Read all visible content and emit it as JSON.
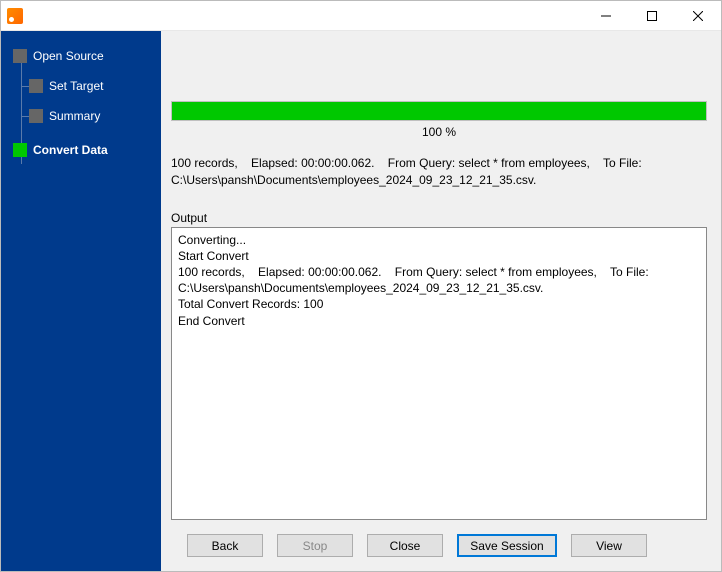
{
  "titlebar": {
    "title": ""
  },
  "sidebar": {
    "items": [
      {
        "label": "Open Source",
        "active": false,
        "bold": false,
        "root": true
      },
      {
        "label": "Set Target",
        "active": false,
        "bold": false,
        "root": false
      },
      {
        "label": "Summary",
        "active": false,
        "bold": false,
        "root": false
      },
      {
        "label": "Convert Data",
        "active": true,
        "bold": true,
        "root": true
      }
    ]
  },
  "progress": {
    "percent": 100,
    "text": "100 %"
  },
  "summary": "100 records,    Elapsed: 00:00:00.062.    From Query: select * from employees,    To File: C:\\Users\\pansh\\Documents\\employees_2024_09_23_12_21_35.csv.",
  "output": {
    "label": "Output",
    "text": "Converting...\nStart Convert\n100 records,    Elapsed: 00:00:00.062.    From Query: select * from employees,    To File: C:\\Users\\pansh\\Documents\\employees_2024_09_23_12_21_35.csv.\nTotal Convert Records: 100\nEnd Convert"
  },
  "buttons": {
    "back": "Back",
    "stop": "Stop",
    "close": "Close",
    "save_session": "Save Session",
    "view": "View"
  }
}
